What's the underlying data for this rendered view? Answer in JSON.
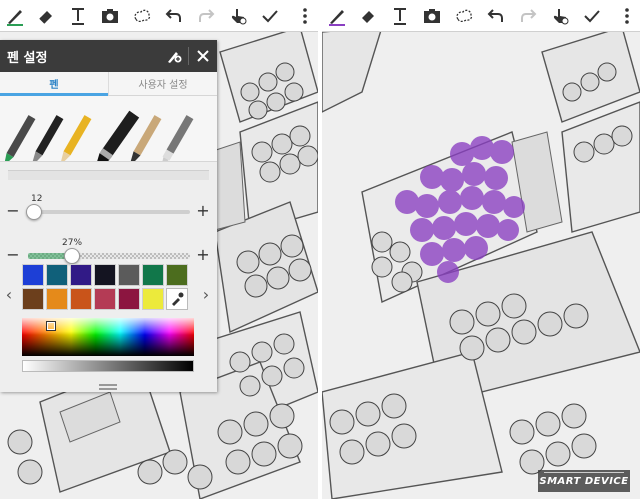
{
  "toolbar": {
    "tools": [
      "pen-icon",
      "eraser-icon",
      "text-icon",
      "image-icon",
      "lasso-icon",
      "undo-icon",
      "redo-icon",
      "touch-icon",
      "done-icon",
      "more-icon"
    ],
    "pen_color": "#2b9e55"
  },
  "pen_settings": {
    "title": "펜 설정",
    "tabs": [
      "펜",
      "사용자 설정"
    ],
    "active_tab": "펜",
    "size": {
      "value_label": "12",
      "fraction": 0.04
    },
    "opacity": {
      "value_label": "27%",
      "fraction": 0.27
    },
    "colors": [
      "#1d3fd6",
      "#10607a",
      "#311a86",
      "#141421",
      "#5b5b5b",
      "#11774a",
      "#4c6d1e",
      "#6c3f1c",
      "#e58a1a",
      "#c9541a",
      "#b43b55",
      "#8c1540",
      "#ecea3b"
    ]
  },
  "watermark": {
    "text": "SMART DEVICE"
  }
}
